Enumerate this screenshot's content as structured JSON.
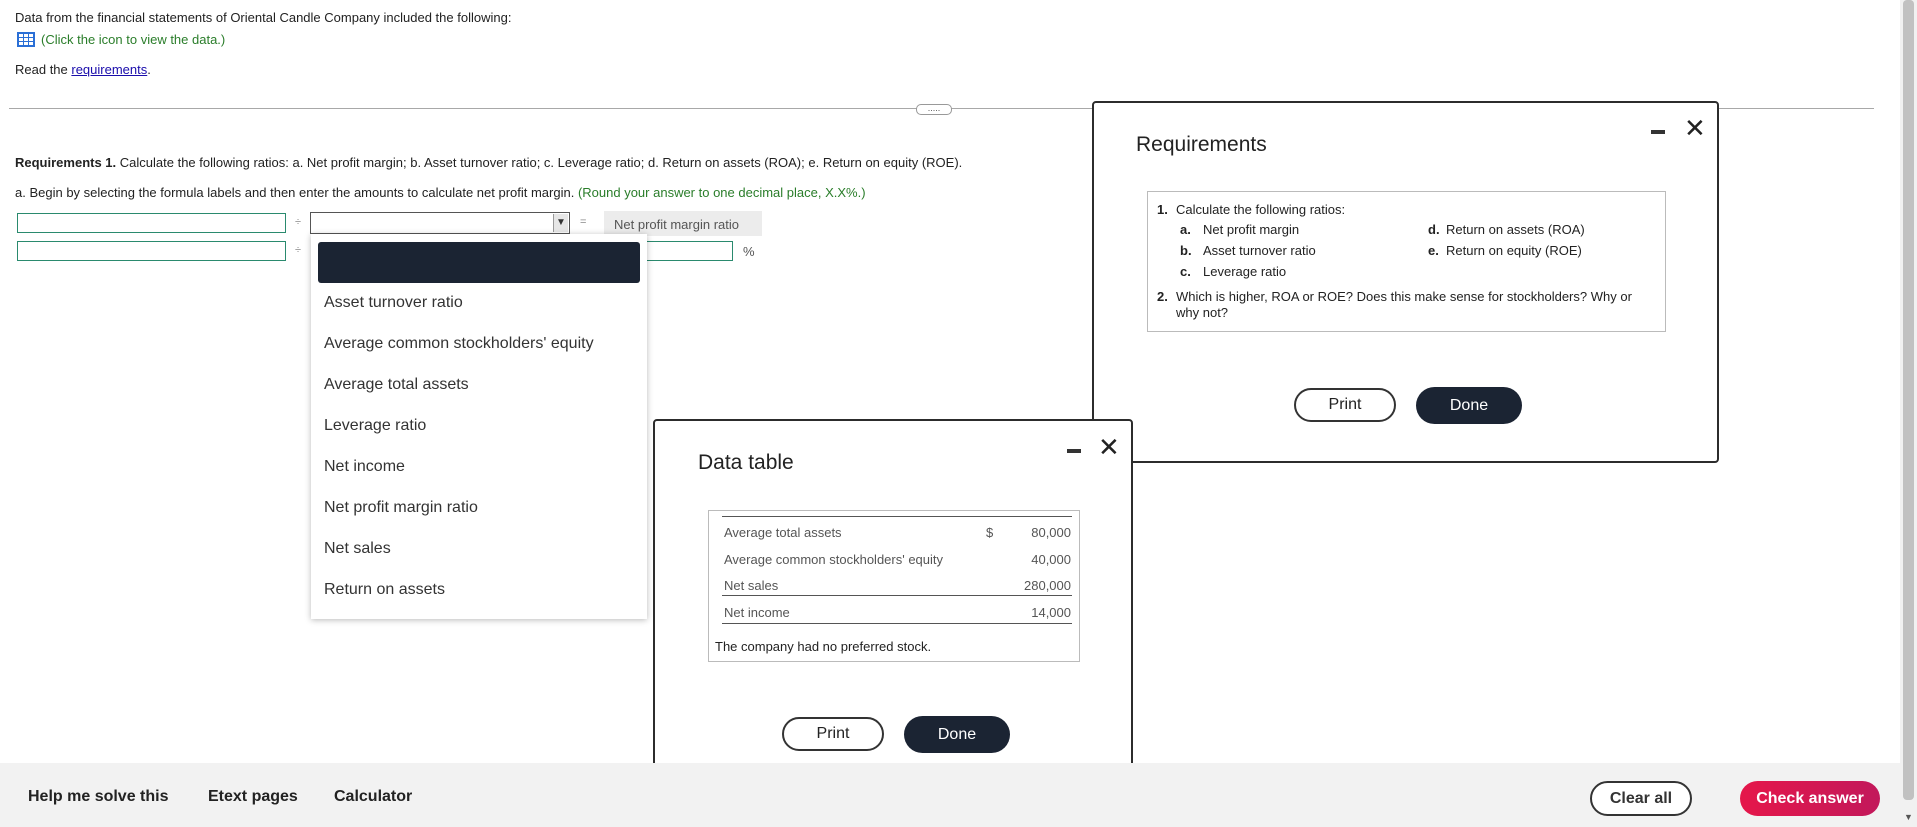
{
  "intro": {
    "text": "Data from the financial statements of Oriental Candle Company included the following:",
    "hint": "(Click the icon to view the data.)",
    "read_prefix": "Read the ",
    "read_link": "requirements",
    "read_suffix": "."
  },
  "splitter": {
    "label": "....."
  },
  "question": {
    "req_bold": "Requirements 1.",
    "req_text": " Calculate the following ratios: a. Net profit margin; b. Asset turnover ratio; c. Leverage ratio; d. Return on assets (ROA); e. Return on equity (ROE).",
    "part_a": "a. Begin by selecting the formula labels and then enter the amounts to calculate net profit margin. ",
    "part_a_hint": "(Round your answer to one decimal place, X.X%.)",
    "divide_sign": "÷",
    "equals_sign": "=",
    "result_label": "Net profit margin ratio",
    "percent_sign": "%",
    "select_arrow": "▼",
    "row1_input": "",
    "row2_input": "",
    "row2_input2": "",
    "result_value": ""
  },
  "dropdown": {
    "items": [
      "Asset turnover ratio",
      "Average common stockholders' equity",
      "Average total assets",
      "Leverage ratio",
      "Net income",
      "Net profit margin ratio",
      "Net sales",
      "Return on assets"
    ]
  },
  "requirements_dialog": {
    "title": "Requirements",
    "item1_num": "1.",
    "item1_text": "Calculate the following ratios:",
    "a_lbl": "a.",
    "a_text": "Net profit margin",
    "b_lbl": "b.",
    "b_text": "Asset turnover ratio",
    "c_lbl": "c.",
    "c_text": "Leverage ratio",
    "d_lbl": "d.",
    "d_text": "Return on assets (ROA)",
    "e_lbl": "e.",
    "e_text": "Return on equity (ROE)",
    "item2_num": "2.",
    "item2_text": "Which is higher, ROA or ROE? Does this make sense for stockholders? Why or why not?",
    "print": "Print",
    "done": "Done"
  },
  "data_dialog": {
    "title": "Data table",
    "rows": [
      {
        "label": "Average total assets",
        "currency": "$",
        "value": "80,000"
      },
      {
        "label": "Average common stockholders' equity",
        "currency": "",
        "value": "40,000"
      },
      {
        "label": "Net sales",
        "currency": "",
        "value": "280,000"
      },
      {
        "label": "Net income",
        "currency": "",
        "value": "14,000"
      }
    ],
    "note": "The company had no preferred stock.",
    "print": "Print",
    "done": "Done"
  },
  "bottom": {
    "help": "Help me solve this",
    "etext": "Etext pages",
    "calculator": "Calculator",
    "clear_all": "Clear all",
    "check_answer": "Check answer"
  },
  "icons": {
    "data_grid": "data-grid-icon",
    "minimize": "minimize-icon",
    "close": "close-icon",
    "dropdown_arrow": "chevron-down-icon"
  },
  "colors": {
    "accent_dark": "#1b2433",
    "hint_green": "#2a7d2a",
    "check_answer": "#e5174a",
    "input_border": "#2a8a6e"
  }
}
